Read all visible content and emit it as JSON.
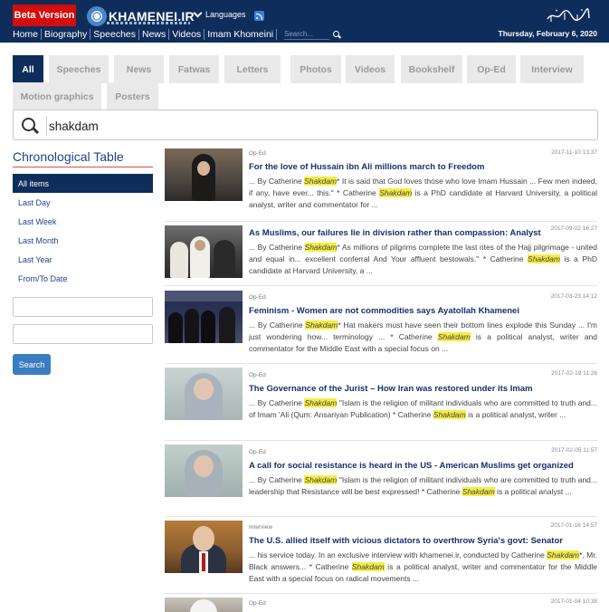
{
  "header": {
    "beta_label": "Beta Version",
    "logo_text": "KHAMENEI.IR",
    "language_label": "Languages",
    "nav": [
      "Home",
      "Biography",
      "Speeches",
      "News",
      "Videos",
      "Imam Khomeini"
    ],
    "search_placeholder": "Search...",
    "date": "Thursday, February 6, 2020",
    "icons": [
      "emblem-logo-icon",
      "chevron-down-icon",
      "rss-icon",
      "search-icon",
      "calligraphy-icon"
    ]
  },
  "tabs": [
    "All",
    "Speeches",
    "News",
    "Fatwas",
    "Letters",
    "Photos",
    "Videos",
    "Bookshelf",
    "Op-Ed",
    "Interview",
    "Motion graphics",
    "Posters"
  ],
  "active_tab": "All",
  "search": {
    "query": "shakdam"
  },
  "sidebar": {
    "title": "Chronological Table",
    "items": [
      "All items",
      "Last Day",
      "Last Week",
      "Last Month",
      "Last Year",
      "From/To Date"
    ],
    "active_item": "All items",
    "search_button": "Search"
  },
  "colors": {
    "header_bg": "#0e2d5b",
    "beta_red": "#d40c0c",
    "accent_blue": "#3a7dc1",
    "highlight": "#f5ed46",
    "title_blue": "#15316b"
  },
  "results": [
    {
      "type": "Op-Ed",
      "date": "2017-11-10 13:37",
      "title": "For the love of Hussain ibn Ali millions march to Freedom",
      "snippet": [
        {
          "t": "...   By Catherine "
        },
        {
          "h": "Shakdam"
        },
        {
          "t": "* It is said that God loves those who love Imam Hussain ...   Few men indeed, if any, have ever... this.\"      * Catherine "
        },
        {
          "h": "Shakdam"
        },
        {
          "t": " is a PhD candidate at Harvard University, a political analyst, writer and commentator for ..."
        }
      ]
    },
    {
      "type": "",
      "date": "2017-09-02 16:27",
      "title": "As Muslims, our failures lie in division rather than compassion: Analyst",
      "snippet": [
        {
          "t": "... By Catherine "
        },
        {
          "h": "Shakdam"
        },
        {
          "t": "* As millions of pilgrims complete the last rites of the Hajj pilgrimage - united and equal in... excellent conferral And Your affluent bestowals.\"   * Catherine "
        },
        {
          "h": "Shakdam"
        },
        {
          "t": " is a PhD candidate at Harvard University, a ..."
        }
      ]
    },
    {
      "type": "Op-Ed",
      "date": "2017-03-23 14:12",
      "title": "Feminism - Women are not commodities says Ayatollah Khamenei",
      "snippet": [
        {
          "t": "... By Catherine "
        },
        {
          "h": "Shakdam"
        },
        {
          "t": "*   Hat makers must have seen their bottom lines explode this Sunday ... I'm just wondering how... terminology ...   * Catherine "
        },
        {
          "h": "Shakdam"
        },
        {
          "t": " is a political analyst, writer and commentator for the Middle East with a special focus on ..."
        }
      ]
    },
    {
      "type": "Op-Ed",
      "date": "2017-02-19 11:26",
      "title": "The Governance of the Jurist – How Iran was restored under its Imam",
      "snippet": [
        {
          "t": "... By Catherine "
        },
        {
          "h": "Shakdam"
        },
        {
          "t": " \"Islam is the religion of militant individuals who are committed to truth and... of Imam 'Ali (Qum: Ansariyan Publication) * Catherine "
        },
        {
          "h": "Shakdam"
        },
        {
          "t": " is a political analyst, writer ..."
        }
      ]
    },
    {
      "type": "Op-Ed",
      "date": "2017-02-05 11:57",
      "title": "A call for social resistance is heard in the US - American Muslims get organized",
      "snippet": [
        {
          "t": "... By Catherine "
        },
        {
          "h": "Shakdam"
        },
        {
          "t": " \"Islam is the religion of militant individuals who are committed to truth and... leadership that Resistance will be best expressed! * Catherine "
        },
        {
          "h": "Shakdam"
        },
        {
          "t": " is a political analyst ..."
        }
      ]
    },
    {
      "type": "Interview",
      "date": "2017-01-16 14:57",
      "title": "The U.S. allied itself with vicious dictators to overthrow Syria's govt: Senator",
      "snippet": [
        {
          "t": "... his service today. In an exclusive interview with khamenei.ir, conducted by Catherine "
        },
        {
          "h": "Shakdam"
        },
        {
          "t": "*, Mr. Black answers...   * Catherine "
        },
        {
          "h": "Shakdam"
        },
        {
          "t": " is a political analyst, writer and commentator for the Middle East with a special focus on radical movements ..."
        }
      ]
    },
    {
      "type": "Op-Ed",
      "date": "2017-01-04 10:38",
      "title": "",
      "snippet": []
    }
  ]
}
